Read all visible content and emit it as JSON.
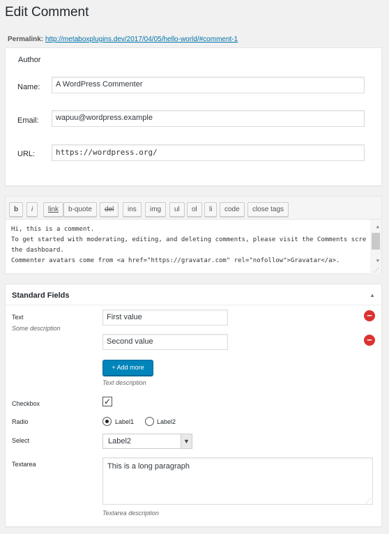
{
  "page": {
    "title": "Edit Comment",
    "permalink_label": "Permalink:",
    "permalink_url": "http://metaboxplugins.dev/2017/04/05/hello-world/#comment-1"
  },
  "author": {
    "title": "Author",
    "name_label": "Name:",
    "name_value": "A WordPress Commenter",
    "email_label": "Email:",
    "email_value": "wapuu@wordpress.example",
    "url_label": "URL:",
    "url_value": "https://wordpress.org/"
  },
  "editor": {
    "buttons": [
      "b",
      "i",
      "link",
      "b-quote",
      "del",
      "ins",
      "img",
      "ul",
      "ol",
      "li",
      "code",
      "close tags"
    ],
    "lines": [
      "Hi, this is a comment.",
      "To get started with moderating, editing, and deleting comments, please visit the Comments screen in",
      "the dashboard.",
      "Commenter avatars come from <a href=\"https://gravatar.com\" rel=\"nofollow\">Gravatar</a>."
    ]
  },
  "fields": {
    "title": "Standard Fields",
    "text_label": "Text",
    "text_desc": "Some description",
    "text_values": [
      "First value",
      "Second value"
    ],
    "add_more_label": "+ Add more",
    "text_field_desc": "Text description",
    "checkbox_label": "Checkbox",
    "checkbox_mark": "✓",
    "radio_label": "Radio",
    "radio_options": [
      "Label1",
      "Label2"
    ],
    "radio_selected": "Label1",
    "select_label": "Select",
    "select_value": "Label2",
    "textarea_label": "Textarea",
    "textarea_value": "This is a long paragraph",
    "textarea_desc": "Textarea description"
  },
  "icons": {
    "collapse": "arrow-up-icon",
    "remove": "remove-icon",
    "select_arrow": "chevron-down-icon"
  },
  "colors": {
    "primary_button": "#0085ba",
    "remove_button": "#dc3232",
    "link": "#0073aa"
  }
}
